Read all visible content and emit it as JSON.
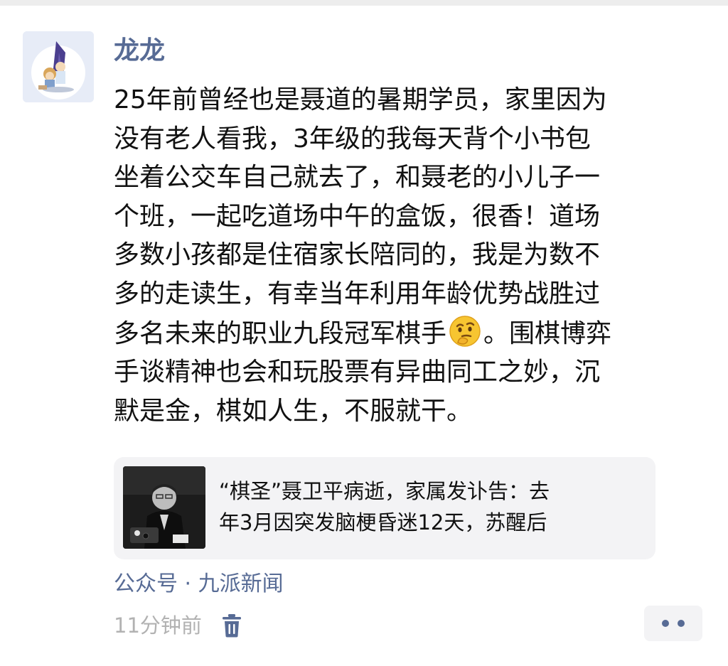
{
  "post": {
    "author": "龙龙",
    "avatar_icon": "cartoon-go-player-avatar",
    "text_before_emoji": "25年前曾经也是聂道的暑期学员，家里因为\n没有老人看我，3年级的我每天背个小书包\n坐着公交车自己就去了，和聂老的小儿子一\n个班，一起吃道场中午的盒饭，很香！道场\n多数小孩都是住宿家长陪同的，我是为数不\n多的走读生，有幸当年利用年龄优势战胜过\n多名未来的职业九段冠军棋手",
    "emoji_icon": "thinking-face-emoji",
    "text_after_emoji": "。围棋博弈\n手谈精神也会和玩股票有异曲同工之妙，沉\n默是金，棋如人生，不服就干。"
  },
  "share_card": {
    "title": "“棋圣”聂卫平病逝，家属发讣告：去\n年3月因突发脑梗昏迷12天，苏醒后",
    "thumbnail_icon": "news-photo-thumbnail"
  },
  "source": {
    "label": "公众号 · 九派新闻"
  },
  "meta": {
    "time": "11分钟前",
    "delete_icon": "trash-icon",
    "more_icon": "more-dots-icon"
  },
  "colors": {
    "link": "#576b95",
    "text": "#111111",
    "muted": "#b2b2b2",
    "card_bg": "#f3f3f5"
  }
}
